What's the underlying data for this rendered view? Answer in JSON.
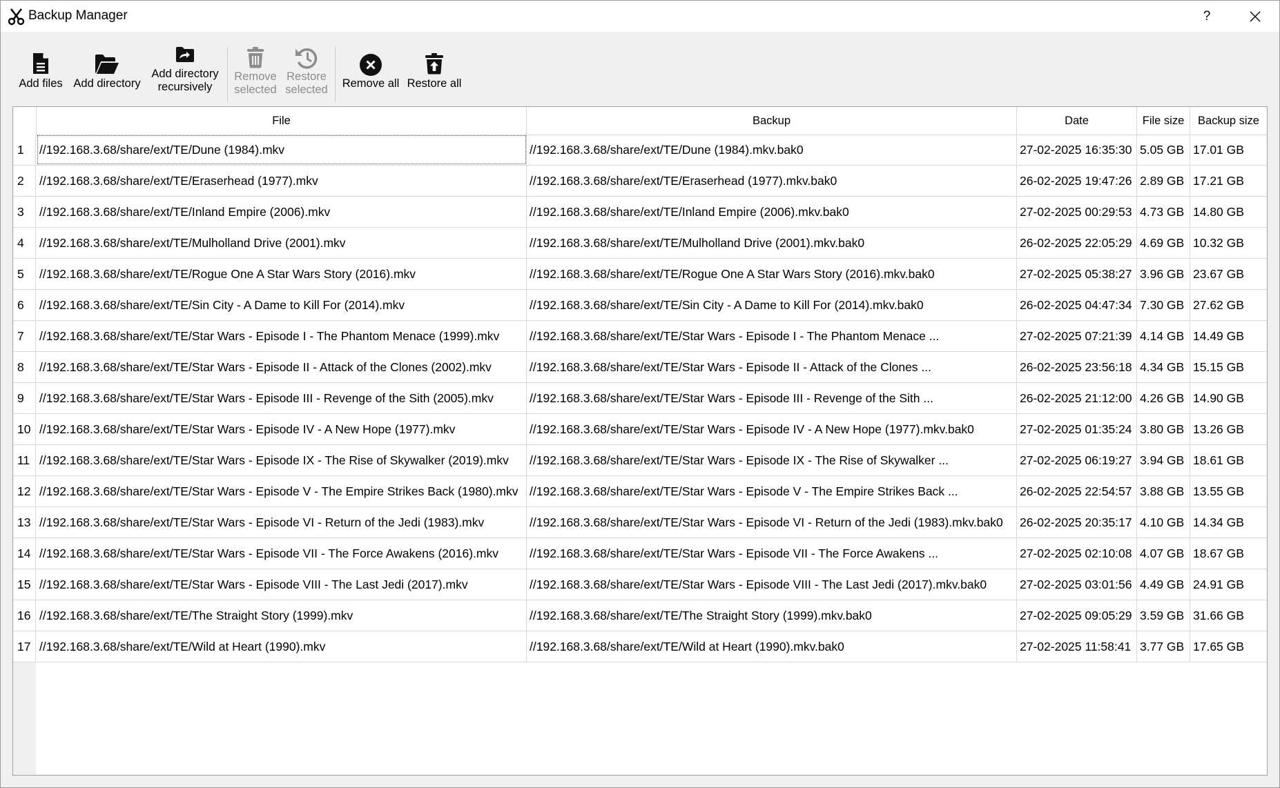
{
  "window": {
    "title": "Backup Manager",
    "help_label": "?"
  },
  "toolbar": {
    "add_files": "Add files",
    "add_directory": "Add directory",
    "add_directory_recursively_line1": "Add directory",
    "add_directory_recursively_line2": "recursively",
    "remove_selected_line1": "Remove",
    "remove_selected_line2": "selected",
    "restore_selected_line1": "Restore",
    "restore_selected_line2": "selected",
    "remove_all": "Remove all",
    "restore_all": "Restore all",
    "disabled_color": "#8c8c8c"
  },
  "table": {
    "columns": [
      "File",
      "Backup",
      "Date",
      "File size",
      "Backup size"
    ],
    "rows": [
      {
        "n": "1",
        "file": "//192.168.3.68/share/ext/TE/Dune (1984).mkv",
        "backup": "//192.168.3.68/share/ext/TE/Dune (1984).mkv.bak0",
        "date": "27-02-2025 16:35:30",
        "size": "5.05 GB",
        "bsize": "17.01 GB"
      },
      {
        "n": "2",
        "file": "//192.168.3.68/share/ext/TE/Eraserhead (1977).mkv",
        "backup": "//192.168.3.68/share/ext/TE/Eraserhead (1977).mkv.bak0",
        "date": "26-02-2025 19:47:26",
        "size": "2.89 GB",
        "bsize": "17.21 GB"
      },
      {
        "n": "3",
        "file": "//192.168.3.68/share/ext/TE/Inland Empire (2006).mkv",
        "backup": "//192.168.3.68/share/ext/TE/Inland Empire (2006).mkv.bak0",
        "date": "27-02-2025 00:29:53",
        "size": "4.73 GB",
        "bsize": "14.80 GB"
      },
      {
        "n": "4",
        "file": "//192.168.3.68/share/ext/TE/Mulholland Drive (2001).mkv",
        "backup": "//192.168.3.68/share/ext/TE/Mulholland Drive (2001).mkv.bak0",
        "date": "26-02-2025 22:05:29",
        "size": "4.69 GB",
        "bsize": "10.32 GB"
      },
      {
        "n": "5",
        "file": "//192.168.3.68/share/ext/TE/Rogue One A Star Wars Story (2016).mkv",
        "backup": "//192.168.3.68/share/ext/TE/Rogue One A Star Wars Story (2016).mkv.bak0",
        "date": "27-02-2025 05:38:27",
        "size": "3.96 GB",
        "bsize": "23.67 GB"
      },
      {
        "n": "6",
        "file": "//192.168.3.68/share/ext/TE/Sin City - A Dame to Kill For (2014).mkv",
        "backup": "//192.168.3.68/share/ext/TE/Sin City - A Dame to Kill For (2014).mkv.bak0",
        "date": "26-02-2025 04:47:34",
        "size": "7.30 GB",
        "bsize": "27.62 GB"
      },
      {
        "n": "7",
        "file": "//192.168.3.68/share/ext/TE/Star Wars - Episode I - The Phantom Menace (1999).mkv",
        "backup": "//192.168.3.68/share/ext/TE/Star Wars - Episode I - The Phantom Menace ...",
        "date": "27-02-2025 07:21:39",
        "size": "4.14 GB",
        "bsize": "14.49 GB"
      },
      {
        "n": "8",
        "file": "//192.168.3.68/share/ext/TE/Star Wars - Episode II - Attack of the Clones (2002).mkv",
        "backup": "//192.168.3.68/share/ext/TE/Star Wars - Episode II - Attack of the Clones ...",
        "date": "26-02-2025 23:56:18",
        "size": "4.34 GB",
        "bsize": "15.15 GB"
      },
      {
        "n": "9",
        "file": "//192.168.3.68/share/ext/TE/Star Wars - Episode III - Revenge of the Sith (2005).mkv",
        "backup": "//192.168.3.68/share/ext/TE/Star Wars - Episode III - Revenge of the Sith ...",
        "date": "26-02-2025 21:12:00",
        "size": "4.26 GB",
        "bsize": "14.90 GB"
      },
      {
        "n": "10",
        "file": "//192.168.3.68/share/ext/TE/Star Wars - Episode IV - A New Hope (1977).mkv",
        "backup": "//192.168.3.68/share/ext/TE/Star Wars - Episode IV - A New Hope (1977).mkv.bak0",
        "date": "27-02-2025 01:35:24",
        "size": "3.80 GB",
        "bsize": "13.26 GB"
      },
      {
        "n": "11",
        "file": "//192.168.3.68/share/ext/TE/Star Wars - Episode IX - The Rise of Skywalker (2019).mkv",
        "backup": "//192.168.3.68/share/ext/TE/Star Wars - Episode IX - The Rise of Skywalker ...",
        "date": "27-02-2025 06:19:27",
        "size": "3.94 GB",
        "bsize": "18.61 GB"
      },
      {
        "n": "12",
        "file": "//192.168.3.68/share/ext/TE/Star Wars - Episode V - The Empire Strikes Back (1980).mkv",
        "backup": "//192.168.3.68/share/ext/TE/Star Wars - Episode V - The Empire Strikes Back ...",
        "date": "26-02-2025 22:54:57",
        "size": "3.88 GB",
        "bsize": "13.55 GB"
      },
      {
        "n": "13",
        "file": "//192.168.3.68/share/ext/TE/Star Wars - Episode VI - Return of the Jedi (1983).mkv",
        "backup": "//192.168.3.68/share/ext/TE/Star Wars - Episode VI - Return of the Jedi (1983).mkv.bak0",
        "date": "26-02-2025 20:35:17",
        "size": "4.10 GB",
        "bsize": "14.34 GB"
      },
      {
        "n": "14",
        "file": "//192.168.3.68/share/ext/TE/Star Wars - Episode VII - The Force Awakens (2016).mkv",
        "backup": "//192.168.3.68/share/ext/TE/Star Wars - Episode VII - The Force Awakens ...",
        "date": "27-02-2025 02:10:08",
        "size": "4.07 GB",
        "bsize": "18.67 GB"
      },
      {
        "n": "15",
        "file": "//192.168.3.68/share/ext/TE/Star Wars - Episode VIII - The Last Jedi (2017).mkv",
        "backup": "//192.168.3.68/share/ext/TE/Star Wars - Episode VIII - The Last Jedi (2017).mkv.bak0",
        "date": "27-02-2025 03:01:56",
        "size": "4.49 GB",
        "bsize": "24.91 GB"
      },
      {
        "n": "16",
        "file": "//192.168.3.68/share/ext/TE/The Straight Story (1999).mkv",
        "backup": "//192.168.3.68/share/ext/TE/The Straight Story (1999).mkv.bak0",
        "date": "27-02-2025 09:05:29",
        "size": "3.59 GB",
        "bsize": "31.66 GB"
      },
      {
        "n": "17",
        "file": "//192.168.3.68/share/ext/TE/Wild at Heart (1990).mkv",
        "backup": "//192.168.3.68/share/ext/TE/Wild at Heart (1990).mkv.bak0",
        "date": "27-02-2025 11:58:41",
        "size": "3.77 GB",
        "bsize": "17.65 GB"
      }
    ]
  },
  "icons": {
    "app": "scissors-icon",
    "add_files": "file-icon",
    "add_directory": "folder-open-icon",
    "add_directory_recursively": "folder-recursive-icon",
    "remove_selected": "trash-icon",
    "restore_selected": "history-icon",
    "remove_all": "x-circle-icon",
    "restore_all": "trash-restore-icon"
  }
}
